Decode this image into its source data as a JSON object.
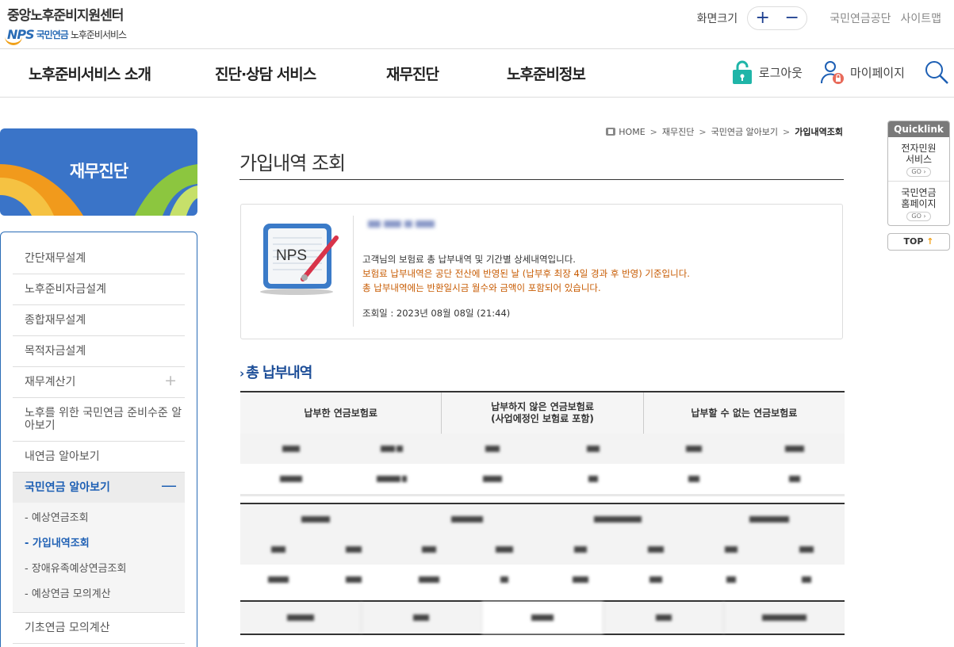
{
  "header": {
    "logo_title": "중앙노후준비지원센터",
    "logo_mark": "NPS",
    "logo_sub_org": "국민연금",
    "logo_sub_service": "노후준비서비스",
    "zoom_label": "화면크기",
    "zoom_in": "+",
    "zoom_out": "−",
    "link_nps": "국민연금공단",
    "link_sitemap": "사이트맵"
  },
  "gnb": {
    "menu": [
      "노후준비서비스 소개",
      "진단·상담 서비스",
      "재무진단",
      "노후준비정보"
    ],
    "logout": "로그아웃",
    "mypage": "마이페이지",
    "search_icon": "search-icon",
    "colors": {
      "lock": "#1fb5a8",
      "accent": "#1d5fb4"
    }
  },
  "lnb": {
    "title": "재무진단",
    "items": [
      "간단재무설계",
      "노후준비자금설계",
      "종합재무설계",
      "목적자금설계",
      "재무계산기",
      "노후를 위한 국민연금 준비수준 알아보기",
      "내연금 알아보기",
      "국민연금 알아보기",
      "기초연금 모의계산"
    ],
    "expand_symbol": "+",
    "collapse_symbol": "—",
    "sub_items": [
      "- 예상연금조회",
      "- 가입내역조회",
      "- 장애유족예상연금조회",
      "- 예상연금 모의계산"
    ]
  },
  "breadcrumb": [
    "HOME",
    "재무진단",
    "국민연금 알아보기",
    "가입내역조회"
  ],
  "breadcrumb_sep": ">",
  "page_title": "가입내역 조회",
  "info": {
    "doc_label": "NPS",
    "line1": "고객님의 보험료 총 납부내역 및 기간별 상세내역입니다.",
    "line2": "보험료 납부내역은 공단 전산에 반영된 날 (납부후 최장 4일 경과 후 반영) 기준입니다.",
    "line3": "총 납부내역에는 반환일시금 월수와 금액이 포함되어 있습니다.",
    "date": "조회일 : 2023년 08월 08일 (21:44)"
  },
  "section_title": "총 납부내역",
  "section_chevron": "›",
  "table_headers": [
    "납부한 연금보험료",
    "납부하지 않은 연금보험료\n(사업에정인 보험료 포함)",
    "납부할 수 없는 연금보험료"
  ],
  "quicklink": {
    "title": "Quicklink",
    "items": [
      "전자민원\n서비스",
      "국민연금\n홈페이지"
    ],
    "go_label": "GO",
    "top_label": "TOP"
  }
}
